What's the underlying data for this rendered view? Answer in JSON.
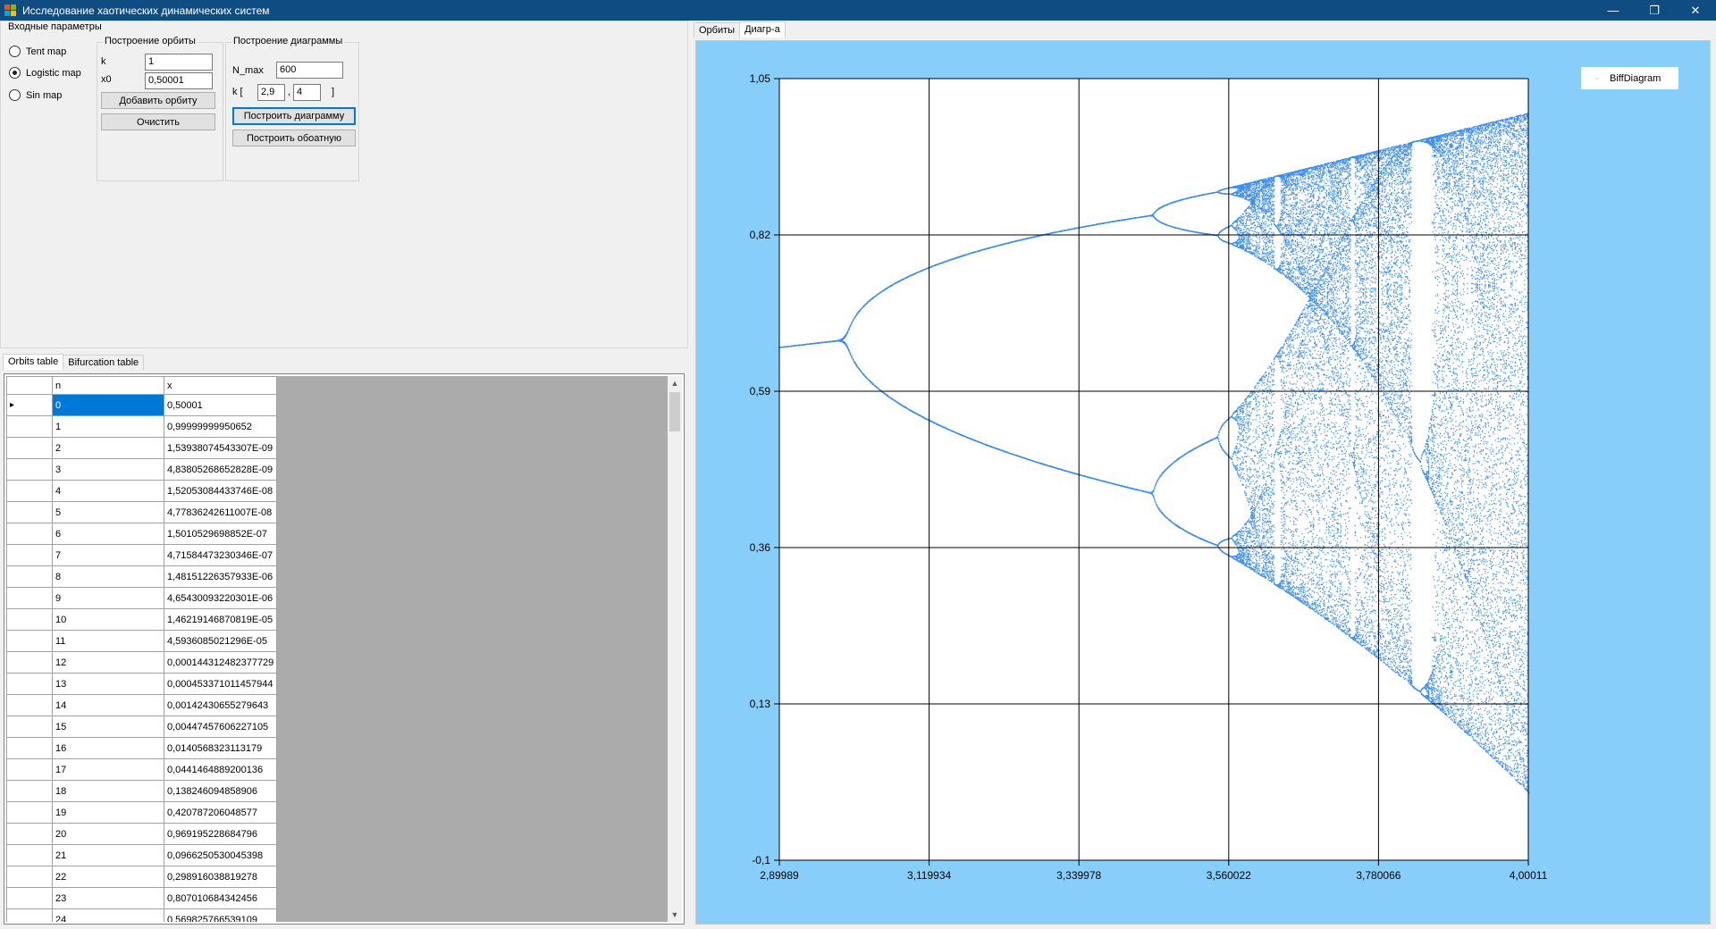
{
  "window": {
    "title": "Исследование хаотических динамических систем",
    "controls": [
      "—",
      "❐",
      "✕"
    ]
  },
  "params": {
    "group_title": "Входные параметры",
    "maps": [
      {
        "label": "Tent map",
        "selected": false
      },
      {
        "label": "Logistic map",
        "selected": true
      },
      {
        "label": "Sin map",
        "selected": false
      }
    ]
  },
  "orbit": {
    "group_title": "Построение орбиты",
    "k_label": "k",
    "k_value": "1",
    "x0_label": "x0",
    "x0_value": "0,50001",
    "add_button": "Добавить орбиту",
    "clear_button": "Очистить"
  },
  "diagram": {
    "group_title": "Построение диаграммы",
    "nmax_label": "N_max",
    "nmax_value": "600",
    "k_open": "k [",
    "k_from": "2,9",
    "k_sep": ",",
    "k_to": "4",
    "k_close": "]",
    "build_button": "Построить диаграмму",
    "build_reverse_button": "Построить обоатную"
  },
  "left_tabs": [
    "Orbits table",
    "Bifurcation table"
  ],
  "right_tabs": [
    "Орбиты",
    "Диагр-а"
  ],
  "table": {
    "columns": [
      "n",
      "x"
    ],
    "rows": [
      [
        "0",
        "0,50001"
      ],
      [
        "1",
        "0,99999999950652"
      ],
      [
        "2",
        "1,53938074543307E-09"
      ],
      [
        "3",
        "4,83805268652828E-09"
      ],
      [
        "4",
        "1,52053084433746E-08"
      ],
      [
        "5",
        "4,77836242611007E-08"
      ],
      [
        "6",
        "1,5010529698852E-07"
      ],
      [
        "7",
        "4,71584473230346E-07"
      ],
      [
        "8",
        "1,48151226357933E-06"
      ],
      [
        "9",
        "4,65430093220301E-06"
      ],
      [
        "10",
        "1,46219146870819E-05"
      ],
      [
        "11",
        "4,5936085021296E-05"
      ],
      [
        "12",
        "0,000144312482377729"
      ],
      [
        "13",
        "0,000453371011457944"
      ],
      [
        "14",
        "0,00142430655279643"
      ],
      [
        "15",
        "0,00447457606227105"
      ],
      [
        "16",
        "0,0140568323113179"
      ],
      [
        "17",
        "0,0441464889200136"
      ],
      [
        "18",
        "0,138246094858906"
      ],
      [
        "19",
        "0,420787206048577"
      ],
      [
        "20",
        "0,969195228684796"
      ],
      [
        "21",
        "0,0966250530045398"
      ],
      [
        "22",
        "0,298916038819278"
      ],
      [
        "23",
        "0,807010684342456"
      ],
      [
        "24",
        "0,569825766539109"
      ]
    ]
  },
  "chart_data": {
    "type": "scatter",
    "series": [
      {
        "name": "BiffDiagram",
        "color": "#3f8ef0",
        "map": "logistic",
        "k_range": [
          2.9,
          4.0
        ]
      }
    ],
    "x_ticks": [
      "2,89989",
      "3,119934",
      "3,339978",
      "3,560022",
      "3,780066",
      "4,00011"
    ],
    "y_ticks": [
      "1,05",
      "0,82",
      "0,59",
      "0,36",
      "0,13",
      "-0,1"
    ],
    "xlim": [
      2.89989,
      4.00011
    ],
    "ylim": [
      -0.1,
      1.05
    ],
    "grid": true,
    "legend": "top-right",
    "background": "#87cefa",
    "plot_background": "#ffffff"
  }
}
